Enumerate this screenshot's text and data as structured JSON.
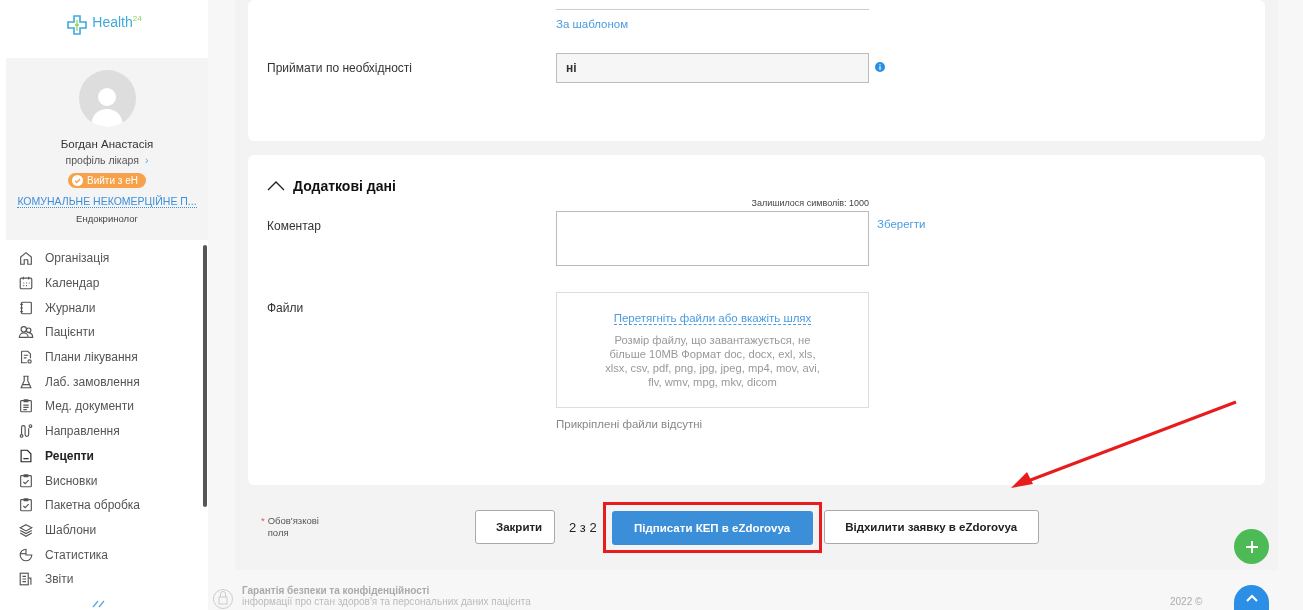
{
  "logo": {
    "text": "Health",
    "superscript": "24"
  },
  "profile": {
    "name": "Богдан Анастасія",
    "profile_link": "профіль лікаря",
    "chevron": "›",
    "logout_button": "Вийти з еН",
    "organization": "КОМУНАЛЬНЕ НЕКОМЕРЦІЙНЕ П...",
    "specialty": "Ендокринолог"
  },
  "nav": [
    {
      "label": "Організація",
      "kind": "home",
      "selected": false
    },
    {
      "label": "Календар",
      "kind": "calendar",
      "selected": false
    },
    {
      "label": "Журнали",
      "kind": "notebook",
      "selected": false
    },
    {
      "label": "Пацієнти",
      "kind": "people",
      "selected": false
    },
    {
      "label": "Плани лікування",
      "kind": "plan",
      "selected": false
    },
    {
      "label": "Лаб. замовлення",
      "kind": "flask",
      "selected": false
    },
    {
      "label": "Мед. документи",
      "kind": "clipboard",
      "selected": false
    },
    {
      "label": "Направлення",
      "kind": "route",
      "selected": false
    },
    {
      "label": "Рецепти",
      "kind": "file",
      "selected": true
    },
    {
      "label": "Висновки",
      "kind": "check",
      "selected": false
    },
    {
      "label": "Пакетна обробка",
      "kind": "check",
      "selected": false
    },
    {
      "label": "Шаблони",
      "kind": "layers",
      "selected": false
    },
    {
      "label": "Статистика",
      "kind": "pie",
      "selected": false
    },
    {
      "label": "Звіти",
      "kind": "report",
      "selected": false
    }
  ],
  "top_card": {
    "template_link": "За шаблоном",
    "field_label": "Приймати по необхідності",
    "field_value": "ні"
  },
  "additional": {
    "title": "Додаткові дані",
    "expanded": true,
    "chars_left": "Залишилося символів: 1000",
    "comment_label": "Коментар",
    "save_link": "Зберегти",
    "files_label": "Файли",
    "drop_link": "Перетягніть файли або вкажіть шлях",
    "drop_hint": "Розмір файлу, що завантажується, не більше 10MB Формат doc, docx, exl, xls, xlsx, csv, pdf, png, jpg, jpeg, mp4, mov, avi, flv, wmv, mpg, mkv, dicom",
    "no_files": "Прикріплені файли відсутні"
  },
  "actions": {
    "required_mark": "*",
    "required_note": "Обов'язкові поля",
    "close_button": "Закрити",
    "counter": "2 з 2",
    "sign_button": "Підписати КЕП в eZdorovya",
    "reject_button": "Відхилити заявку в eZdorovya"
  },
  "footer": {
    "title": "Гарантія безпеки та конфіденційності",
    "text": "інформації про стан здоров'я та персональних даних пацієнта",
    "copyright": "2022 ©"
  }
}
